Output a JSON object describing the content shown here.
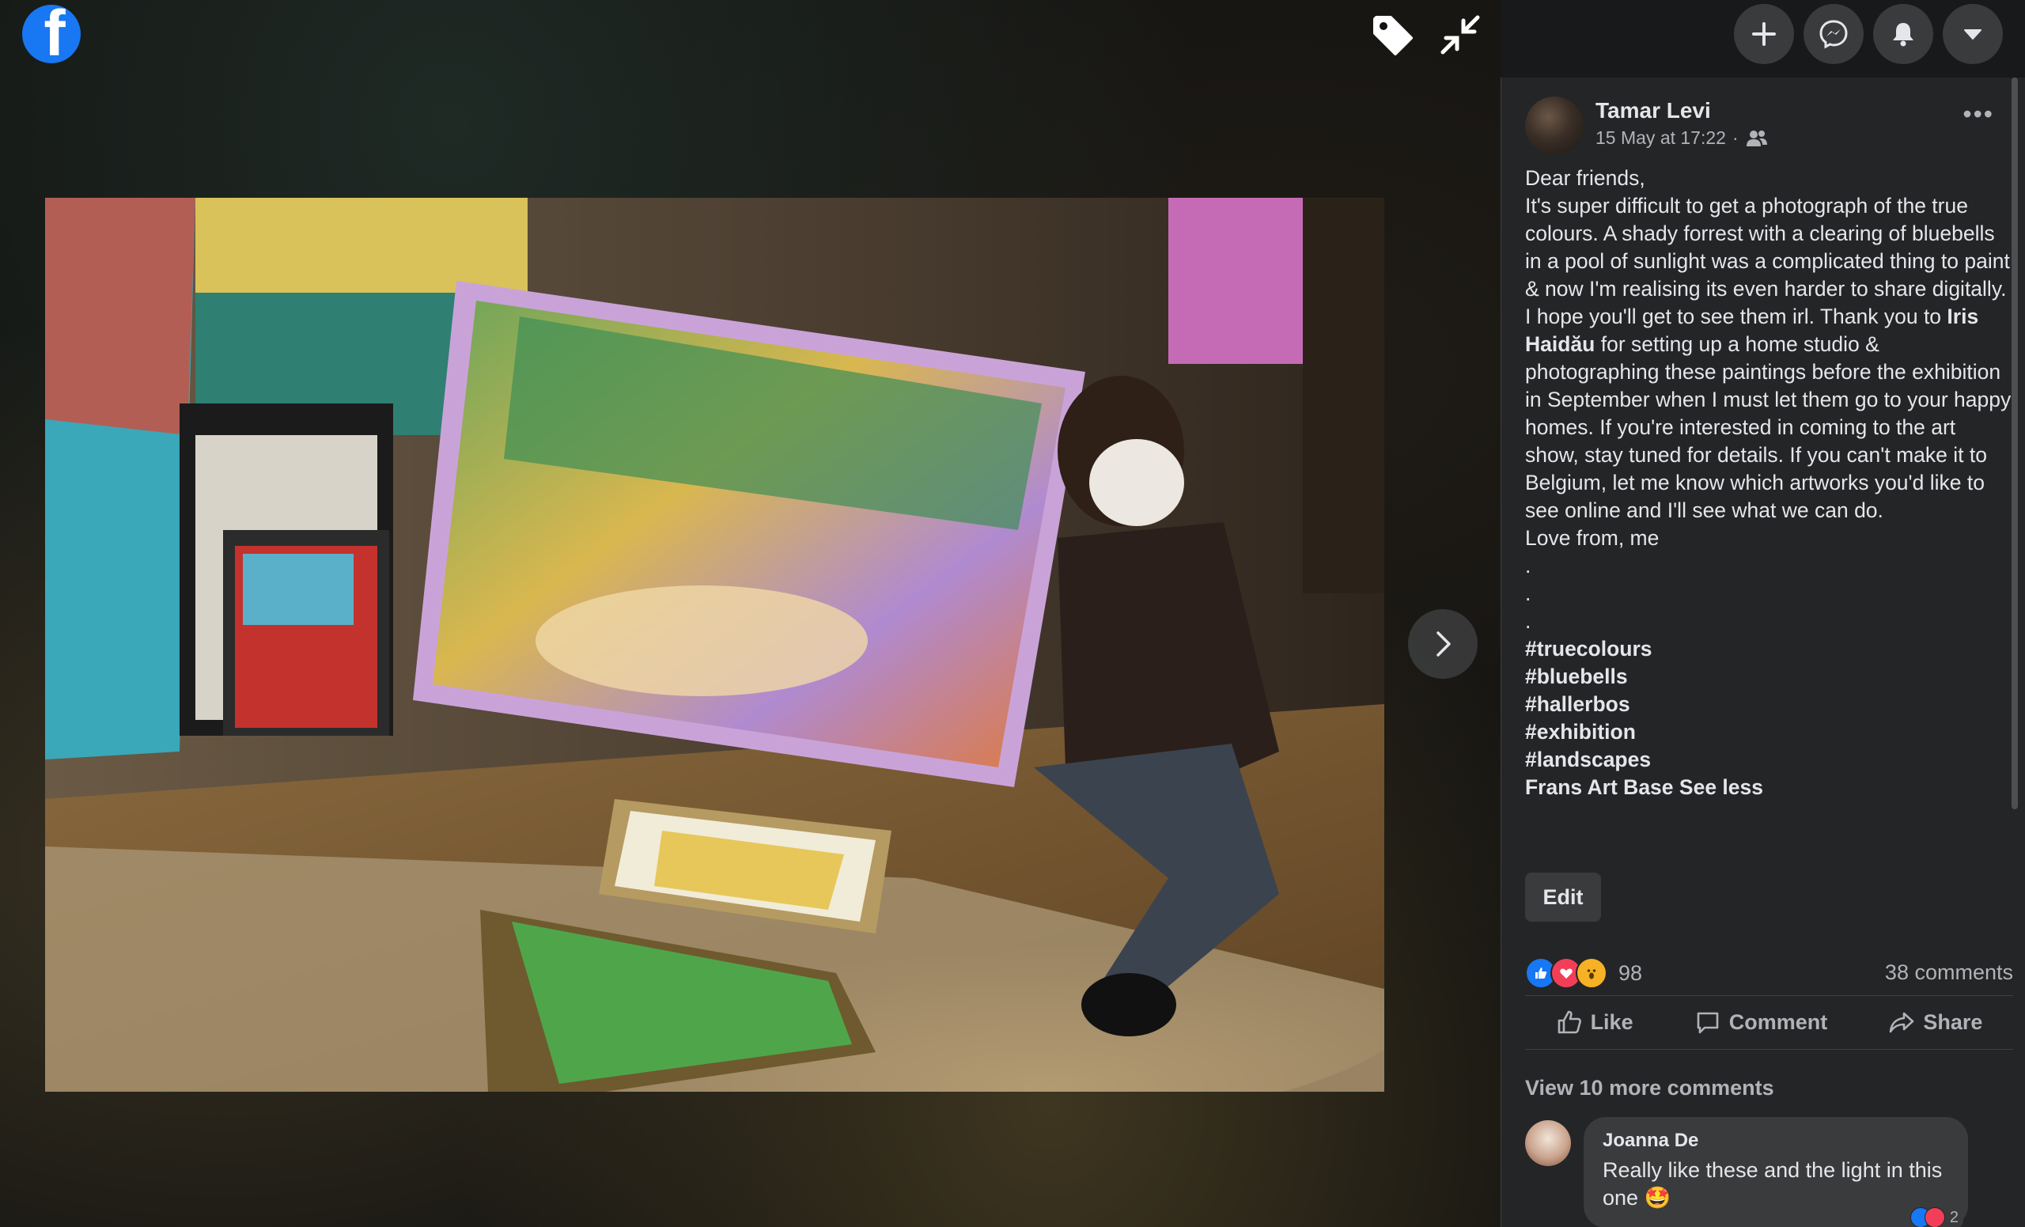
{
  "viewer": {
    "logo_glyph": "f",
    "tag_icon": "tag-icon",
    "collapse_icon": "collapse-icon",
    "next_icon": "chevron-right-icon"
  },
  "header": {
    "buttons": [
      "plus-icon",
      "messenger-icon",
      "bell-icon",
      "caret-down-icon"
    ]
  },
  "post": {
    "author": "Tamar Levi",
    "timestamp": "15 May at 17:22",
    "meta_separator": "·",
    "audience_icon": "friends-icon",
    "more_label": "•••",
    "greeting": "Dear friends,",
    "body_before_mention": "It's super difficult to get a photograph of the true colours. A shady forrest with a clearing of bluebells in a pool of sunlight was a complicated thing to paint & now I'm realising its even harder to share digitally. I hope you'll get to see them irl. Thank you to",
    "mention": "Iris Haidău",
    "body_after_mention": "for setting up a home studio & photographing these paintings before the exhibition in September when I must let them go to your happy homes. If you're interested in coming to the art show, stay tuned for details. If you can't make it to Belgium, let me know which artworks you'd like to see online and I'll see what we can do.",
    "signoff": "Love from, me",
    "dots": [
      ".",
      ".",
      "."
    ],
    "hashtags": [
      "#truecolours",
      "#bluebells",
      "#hallerbos",
      "#exhibition",
      "#landscapes"
    ],
    "page_tag": "Frans Art Base",
    "see_less": "See less",
    "edit_label": "Edit",
    "reaction_count": "98",
    "comments_count": "38 comments",
    "actions": {
      "like": "Like",
      "comment": "Comment",
      "share": "Share"
    },
    "view_more_comments": "View 10 more comments"
  },
  "comment": {
    "author": "Joanna De",
    "text": "Really like these and the light in this one 🤩",
    "reaction_count": "2"
  },
  "colors": {
    "facebook_blue": "#1877f2",
    "panel_bg": "#242526",
    "button_bg": "#3a3b3c"
  }
}
